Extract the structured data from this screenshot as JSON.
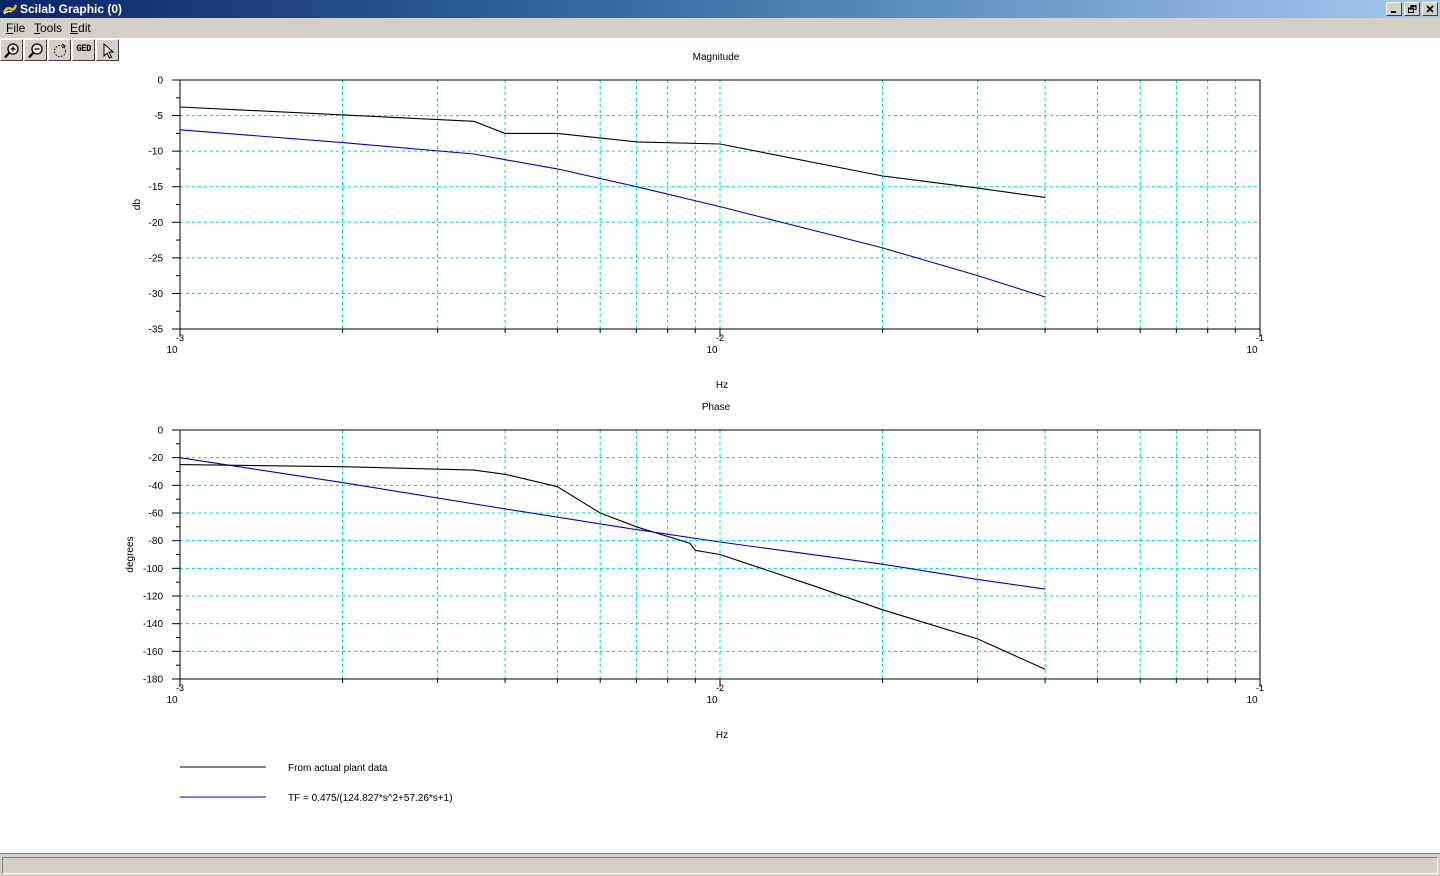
{
  "window": {
    "title": "Scilab Graphic (0)"
  },
  "menu": {
    "items": [
      {
        "accel": "F",
        "rest": "ile"
      },
      {
        "accel": "T",
        "rest": "ools"
      },
      {
        "accel": "E",
        "rest": "dit"
      }
    ]
  },
  "toolbar": {
    "zoom_in_icon": "zoom-in-icon",
    "zoom_out_icon": "zoom-out-icon",
    "rotate_icon": "rotate-icon",
    "ged_label": "GED",
    "pointer_icon": "pointer-icon"
  },
  "colors": {
    "grid": "#00d0d0",
    "series_black": "#000000",
    "series_blue": "#0000c8",
    "title_bar": "#0a246a"
  },
  "chart_data": [
    {
      "type": "line",
      "title": "Magnitude",
      "xlabel": "Hz",
      "ylabel": "db",
      "x_scale": "log",
      "xlim": [
        0.001,
        0.1
      ],
      "ylim": [
        -35,
        0
      ],
      "xticks": [
        {
          "base": "10",
          "exp": "-3"
        },
        {
          "base": "10",
          "exp": "-2"
        },
        {
          "base": "10",
          "exp": "-1"
        }
      ],
      "yticks": [
        "0",
        "-5",
        "-10",
        "-15",
        "-20",
        "-25",
        "-30",
        "-35"
      ],
      "grid": true,
      "series": [
        {
          "color": "#000000",
          "x": [
            0.001,
            0.0035,
            0.004,
            0.005,
            0.007,
            0.01,
            0.02,
            0.03,
            0.04
          ],
          "y": [
            -3.8,
            -5.8,
            -7.5,
            -7.5,
            -8.7,
            -9.0,
            -13.5,
            -15.2,
            -16.5
          ]
        },
        {
          "color": "#0000c8",
          "x": [
            0.001,
            0.002,
            0.0035,
            0.004,
            0.005,
            0.007,
            0.01,
            0.02,
            0.03,
            0.04
          ],
          "y": [
            -7.0,
            -8.8,
            -10.4,
            -11.2,
            -12.5,
            -15.0,
            -17.8,
            -23.6,
            -27.5,
            -30.5
          ]
        }
      ]
    },
    {
      "type": "line",
      "title": "Phase",
      "xlabel": "Hz",
      "ylabel": "degrees",
      "x_scale": "log",
      "xlim": [
        0.001,
        0.1
      ],
      "ylim": [
        -180,
        0
      ],
      "xticks": [
        {
          "base": "10",
          "exp": "-3"
        },
        {
          "base": "10",
          "exp": "-2"
        },
        {
          "base": "10",
          "exp": "-1"
        }
      ],
      "yticks": [
        "0",
        "-20",
        "-40",
        "-60",
        "-80",
        "-100",
        "-120",
        "-140",
        "-160",
        "-180"
      ],
      "grid": true,
      "series": [
        {
          "color": "#000000",
          "x": [
            0.001,
            0.002,
            0.0035,
            0.004,
            0.005,
            0.006,
            0.007,
            0.0088,
            0.009,
            0.01,
            0.015,
            0.02,
            0.03,
            0.04
          ],
          "y": [
            -25,
            -26.5,
            -29,
            -32,
            -41,
            -60,
            -70,
            -82,
            -87,
            -90,
            -113,
            -130,
            -151,
            -173
          ]
        },
        {
          "color": "#0000c8",
          "x": [
            0.001,
            0.002,
            0.004,
            0.007,
            0.01,
            0.02,
            0.03,
            0.04
          ],
          "y": [
            -20,
            -38,
            -57,
            -72,
            -81,
            -97,
            -108,
            -115
          ]
        }
      ]
    }
  ],
  "legend": {
    "entries": [
      {
        "label": "From actual plant data",
        "color": "#000000"
      },
      {
        "label": "TF = 0.475/(124.827*s^2+57.26*s+1)",
        "color": "#0000c8"
      }
    ]
  }
}
